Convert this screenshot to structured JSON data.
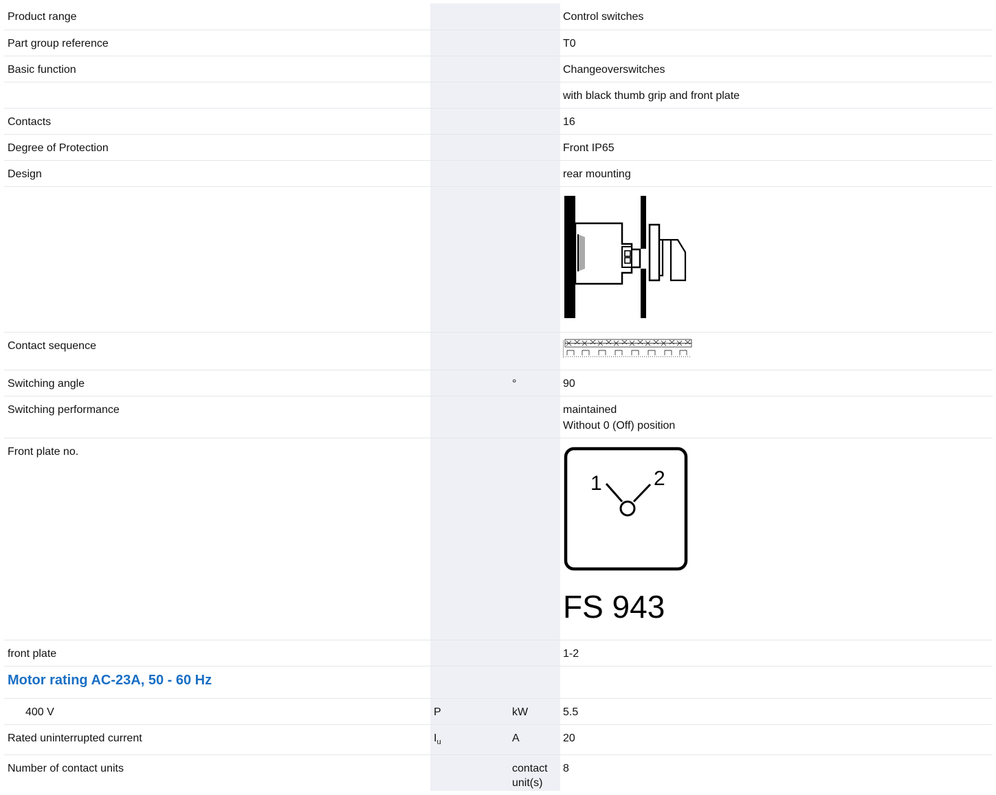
{
  "rows": [
    {
      "label": "Product range",
      "value": "Control switches"
    },
    {
      "label": "Part group reference",
      "value": "T0"
    },
    {
      "label": "Basic function",
      "value": "Changeoverswitches"
    },
    {
      "label": "",
      "value": "with black thumb grip and front plate"
    },
    {
      "label": "Contacts",
      "value": "16"
    },
    {
      "label": "Degree of Protection",
      "value": "Front IP65"
    },
    {
      "label": "Design",
      "value": "rear mounting"
    },
    {
      "label": "Contact sequence"
    },
    {
      "label": "Switching angle",
      "unit": "°",
      "value": "90"
    },
    {
      "label": "Switching performance",
      "value_line1": "maintained",
      "value_line2": "Without 0 (Off) position"
    },
    {
      "label": "Front plate no.",
      "front_plate_code": "FS 943",
      "dial_label_left": "1",
      "dial_label_right": "2"
    },
    {
      "label": "front plate",
      "value": "1-2"
    },
    {
      "section": "Motor rating AC-23A, 50 - 60 Hz"
    },
    {
      "label": "400 V",
      "symbol": "P",
      "unit": "kW",
      "value": "5.5"
    },
    {
      "label": "Rated uninterrupted current",
      "symbol": "I",
      "symbol_sub": "u",
      "unit": "A",
      "value": "20"
    },
    {
      "label": "Number of contact units",
      "unit_line1": "contact",
      "unit_line2": "unit(s)",
      "value": "8"
    }
  ],
  "colors": {
    "section": "#1a6fc4",
    "shade": "#eef0f5"
  }
}
